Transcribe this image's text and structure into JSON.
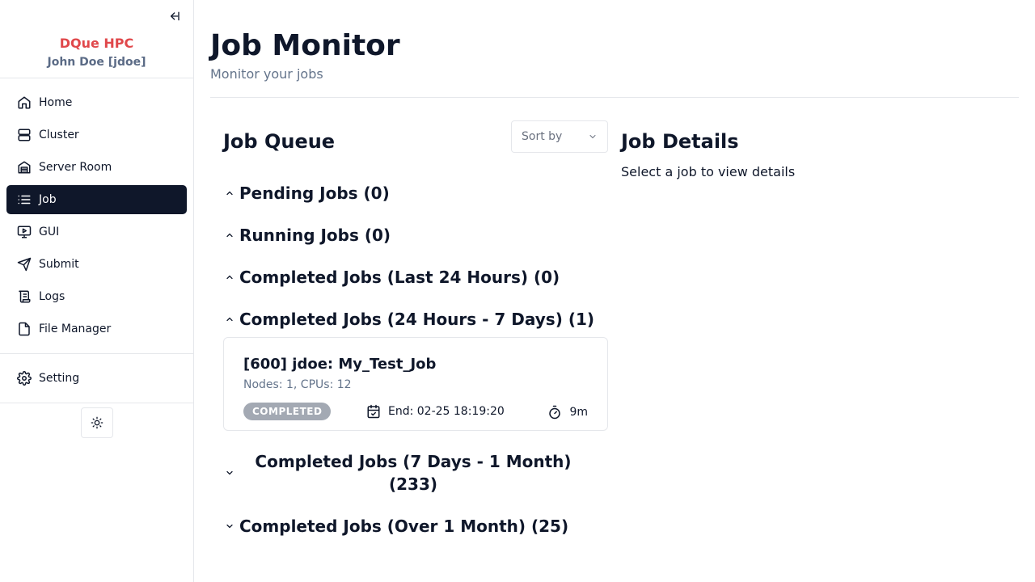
{
  "sidebar": {
    "brand": "DQue HPC",
    "user": "John Doe [jdoe]",
    "items": [
      {
        "label": "Home",
        "icon": "home-icon"
      },
      {
        "label": "Cluster",
        "icon": "server-icon"
      },
      {
        "label": "Server Room",
        "icon": "warehouse-icon"
      },
      {
        "label": "Job",
        "icon": "list-icon",
        "active": true
      },
      {
        "label": "GUI",
        "icon": "monitor-play-icon"
      },
      {
        "label": "Submit",
        "icon": "send-icon"
      },
      {
        "label": "Logs",
        "icon": "scroll-icon"
      },
      {
        "label": "File Manager",
        "icon": "file-icon"
      }
    ],
    "setting": {
      "label": "Setting",
      "icon": "gear-icon"
    }
  },
  "header": {
    "title": "Job Monitor",
    "subtitle": "Monitor your jobs"
  },
  "queue": {
    "title": "Job Queue",
    "sort_placeholder": "Sort by",
    "sections": [
      {
        "label": "Pending Jobs (0)",
        "expanded": true
      },
      {
        "label": "Running Jobs (0)",
        "expanded": true
      },
      {
        "label": "Completed Jobs (Last 24 Hours) (0)",
        "expanded": true
      },
      {
        "label": "Completed Jobs (24 Hours - 7 Days) (1)",
        "expanded": true
      },
      {
        "label": "Completed Jobs (7 Days - 1 Month) (233)",
        "expanded": false
      },
      {
        "label": "Completed Jobs (Over 1 Month) (25)",
        "expanded": false
      }
    ],
    "job": {
      "name": "[600] jdoe: My_Test_Job",
      "resources": "Nodes: 1, CPUs: 12",
      "status": "COMPLETED",
      "end": "End: 02-25 18:19:20",
      "duration": "9m"
    }
  },
  "details": {
    "title": "Job Details",
    "empty": "Select a job to view details"
  },
  "colors": {
    "brand": "#e0484b",
    "active_nav": "#0f172a",
    "badge_completed": "#a3a9b3"
  }
}
